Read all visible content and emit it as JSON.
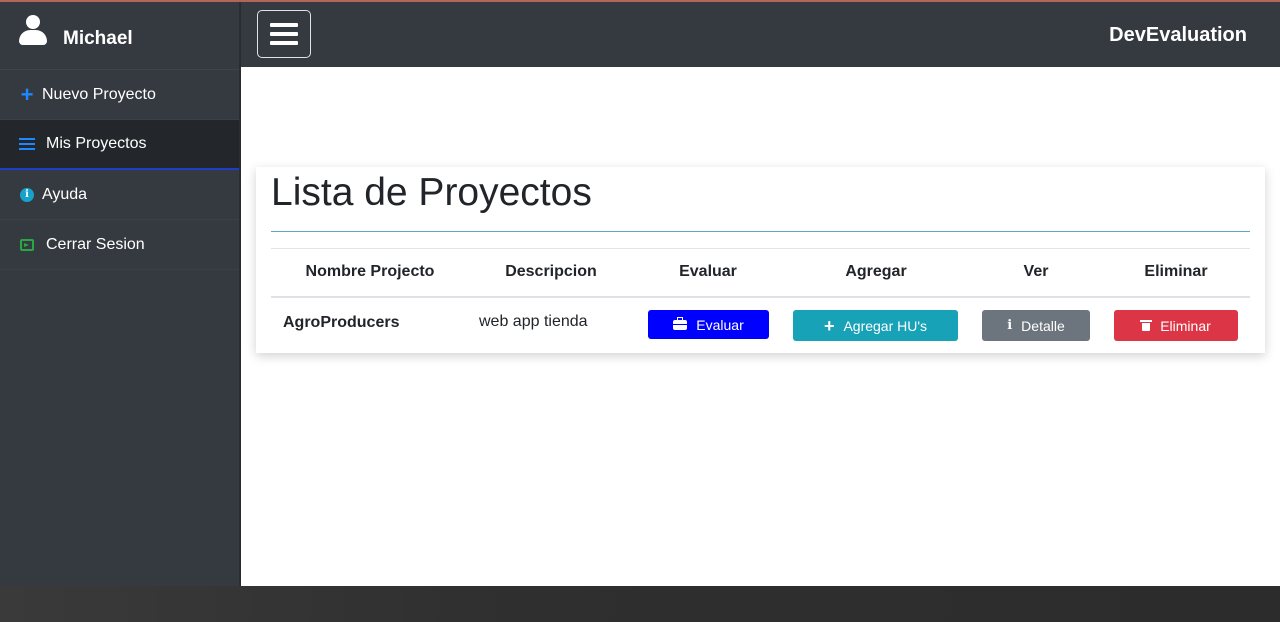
{
  "sidebar": {
    "user_name": "Michael",
    "items": [
      {
        "label": "Nuevo Proyecto",
        "icon": "plus-icon"
      },
      {
        "label": "Mis Proyectos",
        "icon": "list-icon",
        "active": true
      },
      {
        "label": "Ayuda",
        "icon": "info-icon"
      },
      {
        "label": "Cerrar Sesion",
        "icon": "sign-out-icon"
      }
    ]
  },
  "topnav": {
    "brand": "DevEvaluation",
    "menu_icon": "hamburger-icon"
  },
  "main": {
    "title": "Lista de Proyectos",
    "table": {
      "headers": [
        "Nombre Projecto",
        "Descripcion",
        "Evaluar",
        "Agregar",
        "Ver",
        "Eliminar"
      ],
      "rows": [
        {
          "name": "AgroProducers",
          "description": "web app tienda",
          "evaluate_label": "Evaluar",
          "add_label": "Agregar HU's",
          "view_label": "Detalle",
          "delete_label": "Eliminar"
        }
      ]
    }
  },
  "colors": {
    "sidebar_bg": "#343a40",
    "accent_blue": "#0000ff",
    "info": "#17a2b8",
    "secondary": "#6c757d",
    "danger": "#dc3545",
    "success": "#28a745"
  }
}
